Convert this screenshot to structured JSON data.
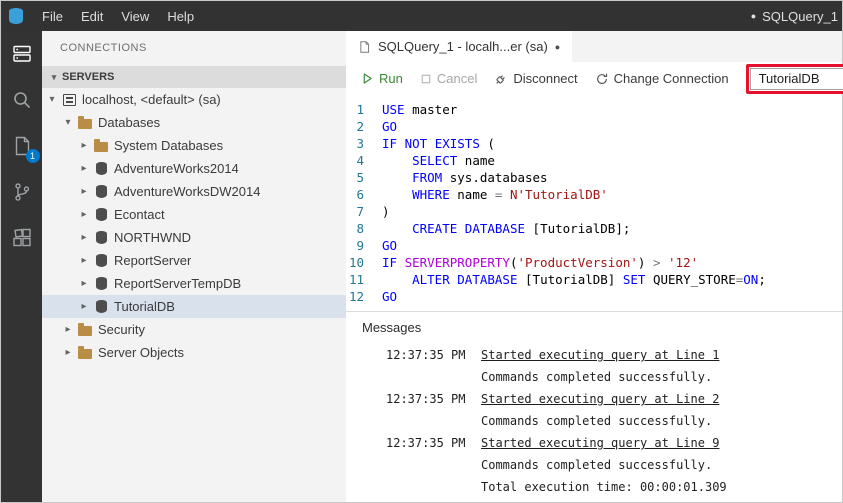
{
  "palette": {
    "keyword_blue": "#0000ff",
    "string_red": "#a31515",
    "function_magenta": "#af00db",
    "operator_gray": "#777777",
    "line_number_teal": "#237893",
    "badge_blue": "#007acc",
    "annotation_red": "#e8112d",
    "run_green": "#388a34",
    "selected_row": "#d9e1ed"
  },
  "titlebar": {
    "menus": [
      "File",
      "Edit",
      "View",
      "Help"
    ],
    "title_dot": "●",
    "title": "SQLQuery_1"
  },
  "activity_bar": {
    "badge": "1"
  },
  "sidebar": {
    "header": "CONNECTIONS",
    "servers_section": "SERVERS",
    "tree": [
      {
        "label": "localhost, <default> (sa)",
        "level": 1,
        "icon": "server",
        "expanded": true,
        "selected": false
      },
      {
        "label": "Databases",
        "level": 2,
        "icon": "folder",
        "expanded": true,
        "selected": false
      },
      {
        "label": "System Databases",
        "level": 3,
        "icon": "folder",
        "expanded": false,
        "selected": false
      },
      {
        "label": "AdventureWorks2014",
        "level": 3,
        "icon": "database",
        "expanded": false,
        "selected": false
      },
      {
        "label": "AdventureWorksDW2014",
        "level": 3,
        "icon": "database",
        "expanded": false,
        "selected": false
      },
      {
        "label": "Econtact",
        "level": 3,
        "icon": "database",
        "expanded": false,
        "selected": false
      },
      {
        "label": "NORTHWND",
        "level": 3,
        "icon": "database",
        "expanded": false,
        "selected": false
      },
      {
        "label": "ReportServer",
        "level": 3,
        "icon": "database",
        "expanded": false,
        "selected": false
      },
      {
        "label": "ReportServerTempDB",
        "level": 3,
        "icon": "database",
        "expanded": false,
        "selected": false
      },
      {
        "label": "TutorialDB",
        "level": 3,
        "icon": "database",
        "expanded": false,
        "selected": true
      },
      {
        "label": "Security",
        "level": 2,
        "icon": "folder",
        "expanded": false,
        "selected": false
      },
      {
        "label": "Server Objects",
        "level": 2,
        "icon": "folder",
        "expanded": false,
        "selected": false
      }
    ]
  },
  "editor": {
    "tab": {
      "label": "SQLQuery_1 - localh...er (sa)",
      "dirty_dot": "●"
    },
    "toolbar": {
      "run": "Run",
      "cancel": "Cancel",
      "disconnect": "Disconnect",
      "change_connection": "Change Connection",
      "database_dropdown_value": "TutorialDB"
    },
    "code_lines": [
      [
        [
          "k",
          "USE"
        ],
        [
          "p",
          " master"
        ]
      ],
      [
        [
          "k",
          "GO"
        ]
      ],
      [
        [
          "k",
          "IF"
        ],
        [
          "p",
          " "
        ],
        [
          "k",
          "NOT"
        ],
        [
          "p",
          " "
        ],
        [
          "k",
          "EXISTS"
        ],
        [
          "p",
          " ("
        ]
      ],
      [
        [
          "p",
          "    "
        ],
        [
          "k",
          "SELECT"
        ],
        [
          "p",
          " name"
        ]
      ],
      [
        [
          "p",
          "    "
        ],
        [
          "k",
          "FROM"
        ],
        [
          "p",
          " sys.databases"
        ]
      ],
      [
        [
          "p",
          "    "
        ],
        [
          "k",
          "WHERE"
        ],
        [
          "p",
          " name "
        ],
        [
          "o",
          "="
        ],
        [
          "p",
          " "
        ],
        [
          "s",
          "N'TutorialDB'"
        ]
      ],
      [
        [
          "p",
          ")"
        ]
      ],
      [
        [
          "p",
          "    "
        ],
        [
          "k",
          "CREATE"
        ],
        [
          "p",
          " "
        ],
        [
          "k",
          "DATABASE"
        ],
        [
          "p",
          " [TutorialDB];"
        ]
      ],
      [
        [
          "k",
          "GO"
        ]
      ],
      [
        [
          "k",
          "IF"
        ],
        [
          "p",
          " "
        ],
        [
          "f",
          "SERVERPROPERTY"
        ],
        [
          "p",
          "("
        ],
        [
          "s",
          "'ProductVersion'"
        ],
        [
          "p",
          ") "
        ],
        [
          "o",
          ">"
        ],
        [
          "p",
          " "
        ],
        [
          "s",
          "'12'"
        ]
      ],
      [
        [
          "p",
          "    "
        ],
        [
          "k",
          "ALTER"
        ],
        [
          "p",
          " "
        ],
        [
          "k",
          "DATABASE"
        ],
        [
          "p",
          " [TutorialDB] "
        ],
        [
          "k",
          "SET"
        ],
        [
          "p",
          " QUERY_STORE"
        ],
        [
          "o",
          "="
        ],
        [
          "k",
          "ON"
        ],
        [
          "p",
          ";"
        ]
      ],
      [
        [
          "k",
          "GO"
        ]
      ]
    ]
  },
  "messages": {
    "title": "Messages",
    "entries": [
      {
        "time": "12:37:35 PM",
        "text": "Started executing query at Line 1",
        "link": true
      },
      {
        "time": "",
        "text": "Commands completed successfully.",
        "link": false
      },
      {
        "time": "12:37:35 PM",
        "text": "Started executing query at Line 2",
        "link": true
      },
      {
        "time": "",
        "text": "Commands completed successfully.",
        "link": false
      },
      {
        "time": "12:37:35 PM",
        "text": "Started executing query at Line 9",
        "link": true
      },
      {
        "time": "",
        "text": "Commands completed successfully.",
        "link": false
      },
      {
        "time": "",
        "text": "Total execution time: 00:00:01.309",
        "link": false
      }
    ]
  }
}
